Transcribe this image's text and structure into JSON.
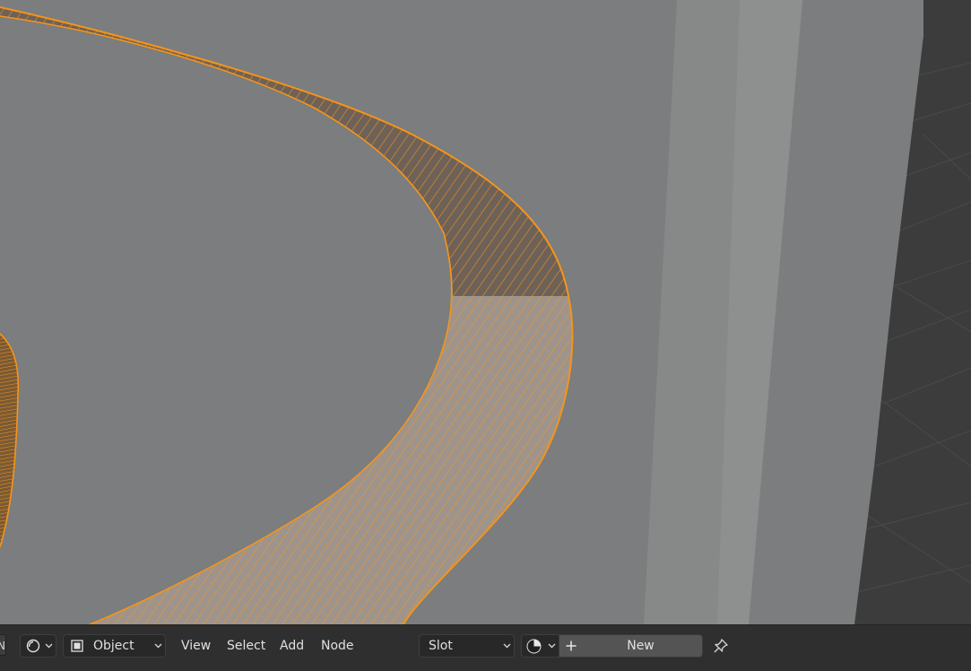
{
  "app": "Blender",
  "edge_tab_label": "N",
  "header": {
    "editor_type_icon": "shader-editor-icon",
    "object_mode": {
      "icon": "object-cube-icon",
      "label": "Object"
    },
    "menus": [
      "View",
      "Select",
      "Add",
      "Node"
    ],
    "slot_dropdown": "Slot",
    "material_browse_icon": "material-sphere-icon",
    "new_button": {
      "icon": "plus-icon",
      "label": "New"
    },
    "pin_icon": "pin-icon"
  },
  "colors": {
    "selection_outline": "#f5941b",
    "header_bg": "#2f2f2f",
    "viewport_surface": "#7a7c7d"
  }
}
